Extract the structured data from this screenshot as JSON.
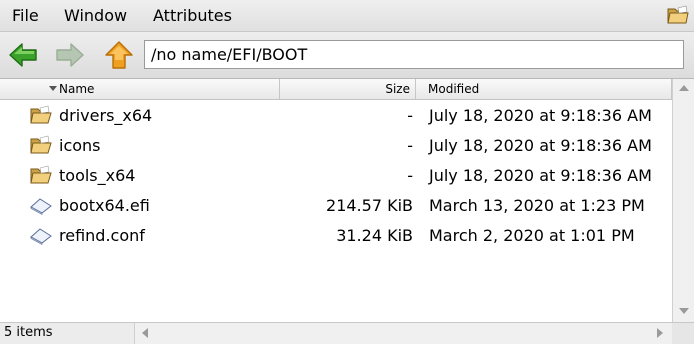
{
  "menubar": {
    "items": [
      "File",
      "Window",
      "Attributes"
    ],
    "folder_icon": "folder-icon"
  },
  "toolbar": {
    "back_icon": "arrow-left-icon",
    "forward_icon": "arrow-right-icon",
    "up_icon": "arrow-up-icon",
    "path": "/no name/EFI/BOOT",
    "colors": {
      "back": "#3aa12a",
      "forward": "#b5c7b2",
      "up": "#f0a020"
    }
  },
  "columns": {
    "name": "Name",
    "size": "Size",
    "modified": "Modified"
  },
  "files": [
    {
      "name": "drivers_x64",
      "size": "-",
      "modified": "July 18, 2020 at 9:18:36 AM",
      "icon": "folder-icon"
    },
    {
      "name": "icons",
      "size": "-",
      "modified": "July 18, 2020 at 9:18:36 AM",
      "icon": "folder-icon"
    },
    {
      "name": "tools_x64",
      "size": "-",
      "modified": "July 18, 2020 at 9:18:36 AM",
      "icon": "folder-icon"
    },
    {
      "name": "bootx64.efi",
      "size": "214.57 KiB",
      "modified": "March 13, 2020 at 1:23 PM",
      "icon": "document-icon"
    },
    {
      "name": "refind.conf",
      "size": "31.24 KiB",
      "modified": "March 2, 2020 at 1:01 PM",
      "icon": "document-icon"
    }
  ],
  "status": {
    "text": "5 items"
  }
}
